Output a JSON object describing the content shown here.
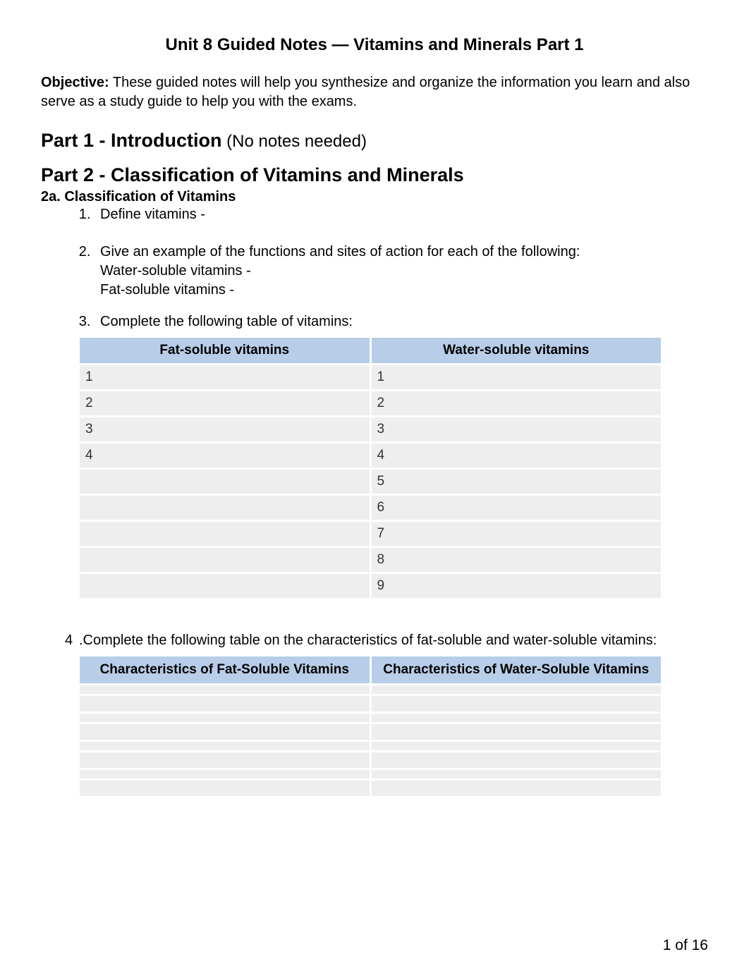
{
  "title": "Unit 8 Guided Notes — Vitamins and Minerals Part 1",
  "objective": {
    "label": "Objective:",
    "text": " These guided notes will help you synthesize and organize the information you learn and also serve as a study guide to help you with the exams."
  },
  "part1": {
    "heading": "Part 1 - Introduction",
    "note": " (No notes needed)"
  },
  "part2": {
    "heading": "Part 2 - Classification of Vitamins and Minerals",
    "sub_a": "2a. Classification of Vitamins",
    "q1": "Define vitamins -",
    "q2": {
      "prompt": "Give an example of the functions and sites of action for each of the following:",
      "line_a": "Water-soluble vitamins -",
      "line_b": "Fat-soluble vitamins -"
    },
    "q3": {
      "prompt": "Complete the following table of vitamins:",
      "col_left": "Fat-soluble vitamins",
      "col_right": "Water-soluble vitamins",
      "left_rows": [
        "1",
        "2",
        "3",
        "4",
        "",
        "",
        "",
        "",
        ""
      ],
      "right_rows": [
        "1",
        "2",
        "3",
        "4",
        "5",
        "6",
        "7",
        "8",
        "9"
      ]
    },
    "q4": {
      "num": "4",
      "prompt": ".Complete the following table on the characteristics of fat-soluble and water-soluble vitamins:",
      "col_left": "Characteristics of Fat-Soluble Vitamins",
      "col_right": "Characteristics of Water-Soluble Vitamins"
    }
  },
  "page_number": "1 of 16"
}
